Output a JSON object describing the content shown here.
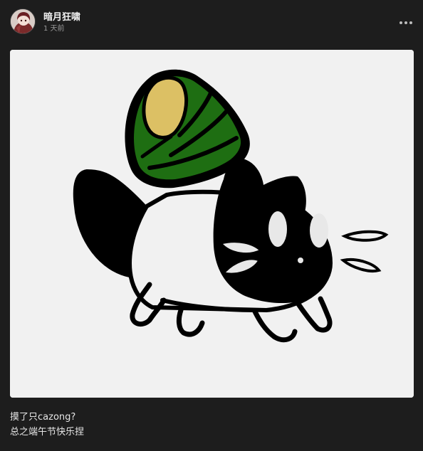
{
  "post": {
    "author": {
      "username": "暗月狂啸",
      "avatar_icon": "anime-avatar-icon"
    },
    "time": "1 天前",
    "more_icon": "more-horizontal-icon",
    "image": {
      "subject": "cat-carrying-zongzi-illustration",
      "colors": {
        "background": "#f1f1f1",
        "leaf_green": "#1e6e12",
        "rice_yellow": "#dcc064",
        "outline": "#000000"
      }
    },
    "caption": {
      "line1": "摸了只cazong?",
      "line2": "总之端午节快乐捏"
    }
  },
  "colors": {
    "page_bg": "#1d1d1d",
    "text_primary": "#f2f2f2",
    "text_secondary": "#9a9a9a"
  }
}
